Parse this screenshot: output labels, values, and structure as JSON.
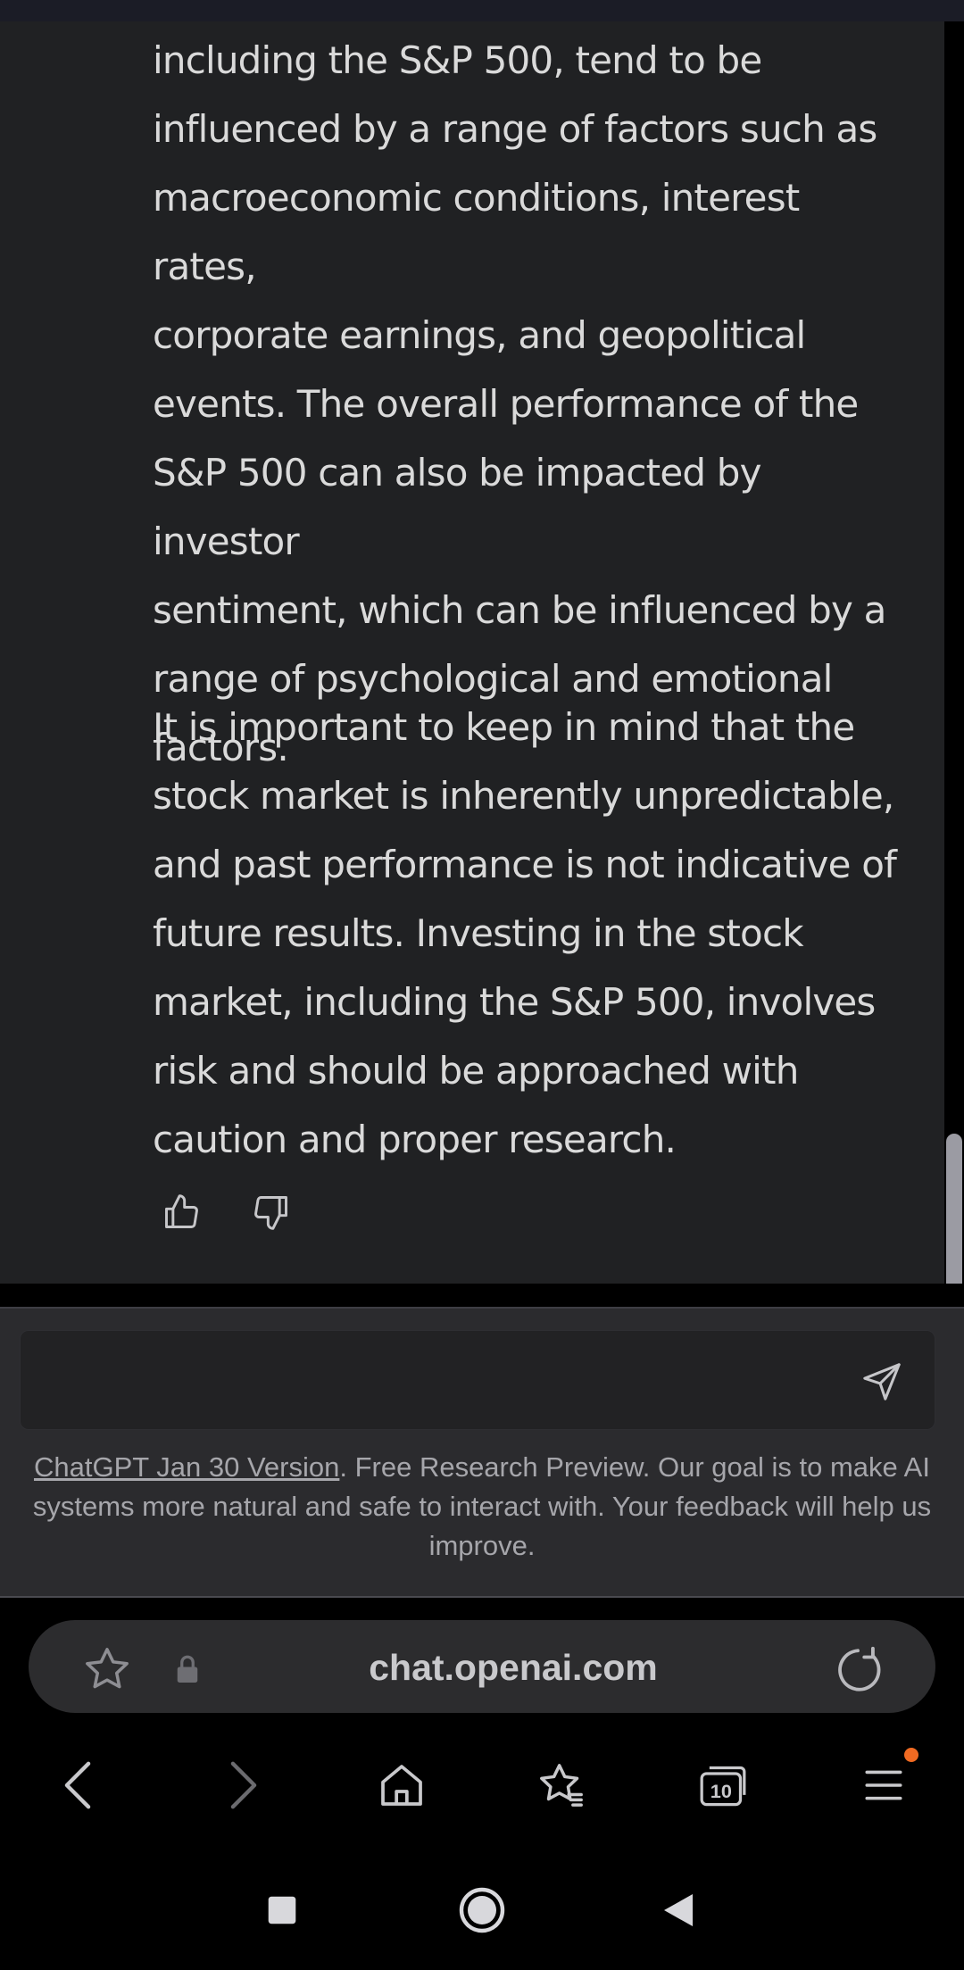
{
  "chat": {
    "paragraphs": [
      {
        "lines": [
          "including the S&P 500, tend to be",
          "influenced by a range of factors such as",
          "macroeconomic conditions, interest rates,",
          "corporate earnings, and geopolitical",
          "events. The overall performance of the",
          "S&P 500 can also be impacted by investor",
          "sentiment, which can be influenced by a",
          "range of psychological and emotional",
          "factors."
        ]
      },
      {
        "lines": [
          "It is important to keep in mind that the",
          "stock market is inherently unpredictable,",
          "and past performance is not indicative of",
          "future results. Investing in the stock",
          "market, including the S&P 500, involves",
          "risk and should be approached with",
          "caution and proper research."
        ]
      }
    ],
    "feedback_icons": [
      "thumbs-up-icon",
      "thumbs-down-icon"
    ]
  },
  "composer": {
    "value": "",
    "send_icon": "send-icon"
  },
  "disclaimer": {
    "link": "ChatGPT Jan 30 Version",
    "text": ". Free Research Preview. Our goal is to make AI systems more natural and safe to interact with. Your feedback will help us improve."
  },
  "browser": {
    "url": "chat.openai.com",
    "icons": [
      "star-icon",
      "lock-icon",
      "reload-icon"
    ],
    "nav_icons": [
      "back-icon",
      "forward-icon",
      "home-icon",
      "bookmarks-icon",
      "tabs-icon",
      "menu-icon"
    ],
    "tab_count": "10",
    "notification_color": "#f06a22"
  },
  "system_nav": {
    "icons": [
      "recents-icon",
      "home-circle-icon",
      "back-triangle-icon"
    ]
  },
  "colors": {
    "chat_background": "#202123",
    "text": "#dadada",
    "url_bar": "#2c2c2e"
  }
}
